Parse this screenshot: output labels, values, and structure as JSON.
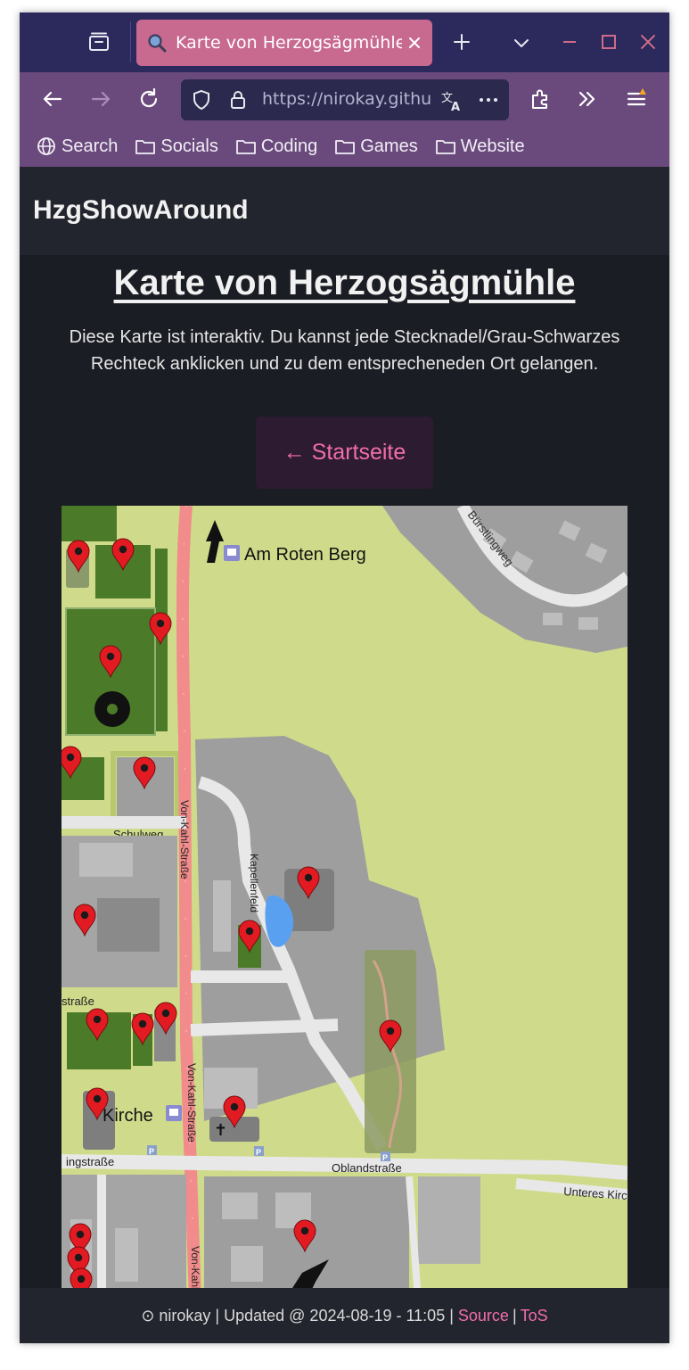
{
  "browser": {
    "tab": {
      "title": "Karte von Herzogsägmühle",
      "favicon": "magnifier-icon"
    },
    "url": "https://nirokay.github.io/HzgShowAround/map.html",
    "bookmarks": [
      {
        "label": "Search",
        "icon": "globe-icon"
      },
      {
        "label": "Socials",
        "icon": "folder-icon"
      },
      {
        "label": "Coding",
        "icon": "folder-icon"
      },
      {
        "label": "Games",
        "icon": "folder-icon"
      },
      {
        "label": "Website",
        "icon": "folder-icon"
      }
    ],
    "colors": {
      "tabstrip": "#2c2a5c",
      "toolbar": "#6a4a7c",
      "active_tab": "#c8698f"
    }
  },
  "site": {
    "brand": "HzgShowAround",
    "title": "Karte von Herzogsägmühle",
    "description": "Diese Karte ist interaktiv. Du kannst jede Stecknadel/Grau-Schwarzes Rechteck anklicken und zu dem entsprecheneden Ort gelangen.",
    "home_button": "← Startseite",
    "accent": "#f06eab"
  },
  "map": {
    "labels": {
      "bus_stop_north": "Am Roten Berg",
      "bus_stop_church": "Kirche",
      "street_buerstlingweg": "Bürstlingweg",
      "street_schulweg": "Schulweg",
      "street_vonkahl_1": "Von-Kahl-Straße",
      "street_vonkahl_2": "Von-Kahl-Straße",
      "street_vonkahl_3": "Von-Kahl-S",
      "street_kapellenfeld": "Kapellenfeld",
      "street_west": "straße",
      "street_ingstrasse": "ingstraße",
      "street_oblandstrasse": "Oblandstraße",
      "street_unteres": "Unteres Kirc",
      "parking_1": "P",
      "parking_2": "P",
      "parking_3": "P"
    }
  },
  "footer": {
    "prefix": "⊙ nirokay | Updated @ 2024-08-19 - 11:05 |",
    "source": "Source",
    "tos": "ToS",
    "pipe": "|"
  }
}
